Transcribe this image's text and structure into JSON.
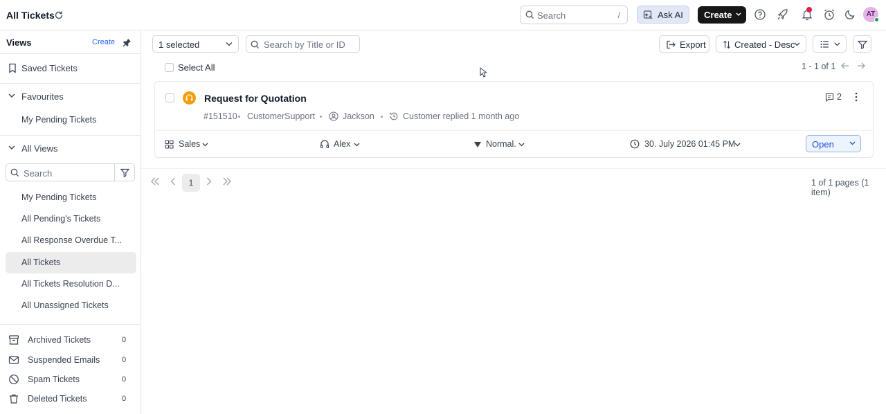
{
  "header": {
    "title": "All Tickets",
    "search_placeholder": "Search",
    "search_shortcut": "/",
    "ask_ai_label": "Ask AI",
    "create_label": "Create",
    "avatar_initials": "AT"
  },
  "sidebar": {
    "views_label": "Views",
    "create_label": "Create",
    "saved_tickets": "Saved Tickets",
    "favourites_label": "Favourites",
    "favourites": [
      "My Pending Tickets"
    ],
    "all_views_label": "All Views",
    "search_placeholder": "Search",
    "views": [
      "My Pending Tickets",
      "All Pending's Tickets",
      "All Response Overdue T...",
      "All Tickets",
      "All Tickets Resolution D...",
      "All Unassigned Tickets"
    ],
    "active_view": "All Tickets",
    "bottom": [
      {
        "label": "Archived Tickets",
        "count": "0"
      },
      {
        "label": "Suspended Emails",
        "count": "0"
      },
      {
        "label": "Spam Tickets",
        "count": "0"
      },
      {
        "label": "Deleted Tickets",
        "count": "0"
      }
    ]
  },
  "toolbar": {
    "selected_label": "1 selected",
    "search_placeholder": "Search by Title or ID",
    "export_label": "Export",
    "sort_label": "Created - Desc"
  },
  "list": {
    "select_all_label": "Select All",
    "range": "1 - 1 of 1"
  },
  "ticket": {
    "title": "Request for Quotation",
    "id": "#151510",
    "team": "CustomerSupport",
    "customer": "Jackson",
    "activity": "Customer replied 1 month ago",
    "comments": "2",
    "group": "Sales",
    "agent": "Alex",
    "priority": "Normal.",
    "due": "30. July 2026 01:45 PM",
    "status": "Open"
  },
  "pagination": {
    "current_page": "1",
    "info": "1 of 1 pages (1 item)"
  }
}
